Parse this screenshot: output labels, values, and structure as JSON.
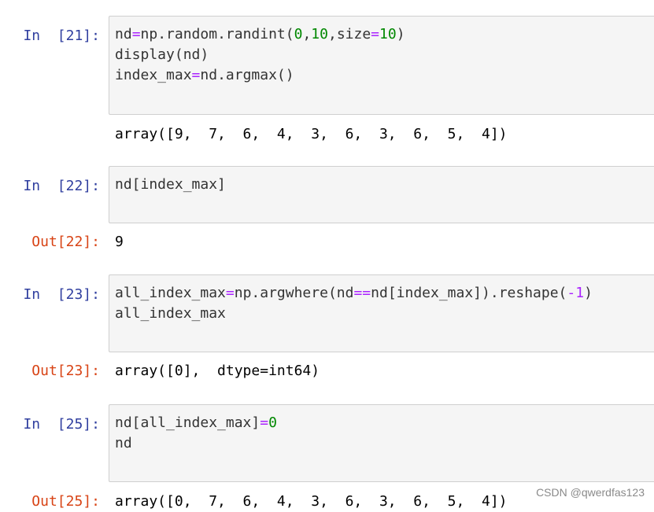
{
  "cells": [
    {
      "in_prompt": "In  [21]:",
      "code": [
        [
          "nd",
          "=",
          "np.random.randint(",
          "0",
          ",",
          "10",
          ",size",
          "=",
          "10",
          ")"
        ],
        [
          "display(nd)"
        ],
        [
          "index_max",
          "=",
          "nd.argmax()"
        ]
      ],
      "output": "array([9,  7,  6,  4,  3,  6,  3,  6,  5,  4])"
    },
    {
      "in_prompt": "In  [22]:",
      "code": [
        [
          "nd[index_max]"
        ]
      ],
      "out_prompt": "Out[22]:",
      "output": "9"
    },
    {
      "in_prompt": "In  [23]:",
      "code": [
        [
          "all_index_max",
          "=",
          "np.argwhere(nd",
          "==",
          "nd[index_max]).reshape(",
          "-1",
          ")"
        ],
        [
          "all_index_max"
        ]
      ],
      "out_prompt": "Out[23]:",
      "output": "array([0],  dtype=int64)"
    },
    {
      "in_prompt": "In  [25]:",
      "code": [
        [
          "nd[all_index_max]",
          "=",
          "0"
        ],
        [
          "nd"
        ]
      ],
      "out_prompt": "Out[25]:",
      "output": "array([0,  7,  6,  4,  3,  6,  3,  6,  5,  4])"
    }
  ],
  "watermark": "CSDN @qwerdfas123",
  "colors": {
    "in_prompt": "#303f9f",
    "out_prompt": "#d84315",
    "operator": "#aa22ff",
    "number": "#008800",
    "input_bg": "#f5f5f5"
  }
}
